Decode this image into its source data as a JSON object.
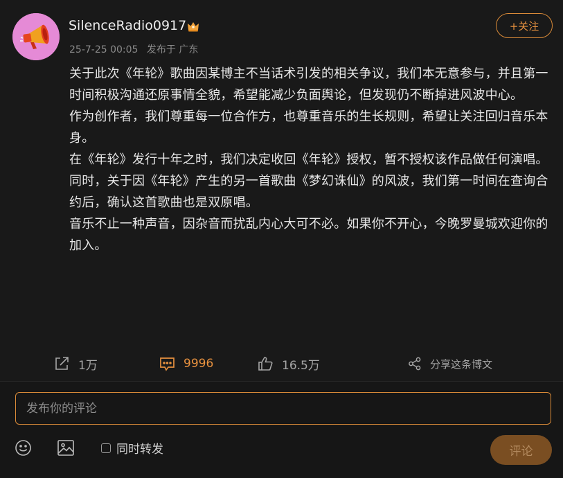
{
  "post": {
    "username": "SilenceRadio0917",
    "date": "25-7-25 00:05",
    "location": "发布于 广东",
    "follow_label": "+关注",
    "paragraphs": [
      "关于此次《年轮》歌曲因某博主不当话术引发的相关争议，我们本无意参与，并且第一时间积极沟通还原事情全貌，希望能减少负面舆论，但发现仍不断掉进风波中心。",
      "作为创作者，我们尊重每一位合作方，也尊重音乐的生长规则，希望让关注回归音乐本身。",
      "在《年轮》发行十年之时，我们决定收回《年轮》授权，暂不授权该作品做任何演唱。",
      "同时，关于因《年轮》产生的另一首歌曲《梦幻诛仙》的风波，我们第一时间在查询合约后，确认这首歌曲也是双原唱。",
      "音乐不止一种声音，因杂音而扰乱内心大可不必。如果你不开心，今晚罗曼城欢迎你的加入。"
    ]
  },
  "actions": {
    "repost_count": "1万",
    "comment_count": "9996",
    "like_count": "16.5万",
    "share_label": "分享这条博文"
  },
  "composer": {
    "placeholder": "发布你的评论",
    "repost_label": "同时转发",
    "submit_label": "评论"
  },
  "colors": {
    "accent": "#e7913f",
    "avatar_bg": "#e58ad6",
    "background": "#191919"
  },
  "icons": {
    "avatar": "megaphone-icon",
    "badge": "crown-icon",
    "repost": "repost-icon",
    "comment": "comment-icon",
    "like": "thumbs-up-icon",
    "share": "share-icon",
    "emoji": "emoji-icon",
    "image": "image-icon"
  }
}
